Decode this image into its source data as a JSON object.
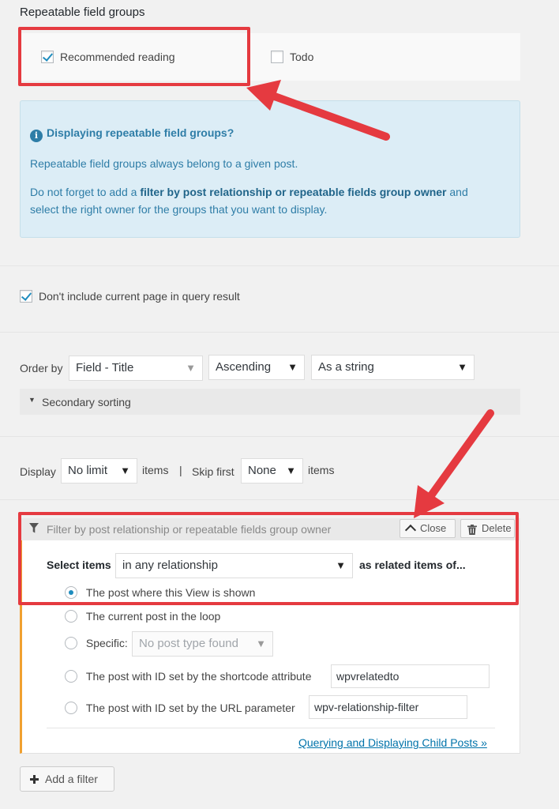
{
  "section": {
    "title": "Repeatable field groups"
  },
  "groups": [
    {
      "label": "Recommended reading",
      "checked": true
    },
    {
      "label": "Todo",
      "checked": false
    }
  ],
  "info": {
    "title": "Displaying repeatable field groups?",
    "line1": "Repeatable field groups always belong to a given post.",
    "line2_prefix": "Do not forget to add a ",
    "line2_bold": "filter by post relationship or repeatable fields group owner",
    "line2_suffix": " and",
    "line3": "select the right owner for the groups that you want to display."
  },
  "exclude_current": {
    "label": "Don't include current page in query result",
    "checked": true
  },
  "ordering": {
    "label": "Order by",
    "field": "Field - Title",
    "direction": "Ascending",
    "as": "As a string",
    "secondary": "Secondary sorting"
  },
  "limits": {
    "display_label": "Display",
    "display_value": "No limit",
    "items1": "items",
    "separator": "|",
    "skip_label": "Skip first",
    "skip_value": "None",
    "items2": "items"
  },
  "filter": {
    "title": "Filter by post relationship or repeatable fields group owner",
    "close_label": "Close",
    "delete_label": "Delete",
    "select_label": "Select items",
    "select_value": "in any relationship",
    "select_suffix": "as related items of...",
    "options": [
      {
        "label": "The post where this View is shown",
        "checked": true
      },
      {
        "label": "The current post in the loop",
        "checked": false
      },
      {
        "label": "Specific:",
        "checked": false
      },
      {
        "label": "The post with ID set by the shortcode attribute",
        "checked": false
      },
      {
        "label": "The post with ID set by the URL parameter",
        "checked": false
      }
    ],
    "specific_placeholder": "No post type found",
    "shortcode_value": "wpvrelatedto",
    "url_value": "wpv-relationship-filter",
    "help_link": "Querying and Displaying Child Posts »"
  },
  "add_filter": {
    "label": "Add a filter"
  },
  "colors": {
    "annotation": "#e53a40",
    "info_text": "#2e7da7",
    "accent": "#1e8cbe",
    "filter_border": "#f0a030"
  },
  "icons": [
    "info-icon",
    "check-icon",
    "funnel-icon",
    "chevron-up-icon",
    "trash-icon",
    "plus-icon",
    "caret-down-icon"
  ]
}
